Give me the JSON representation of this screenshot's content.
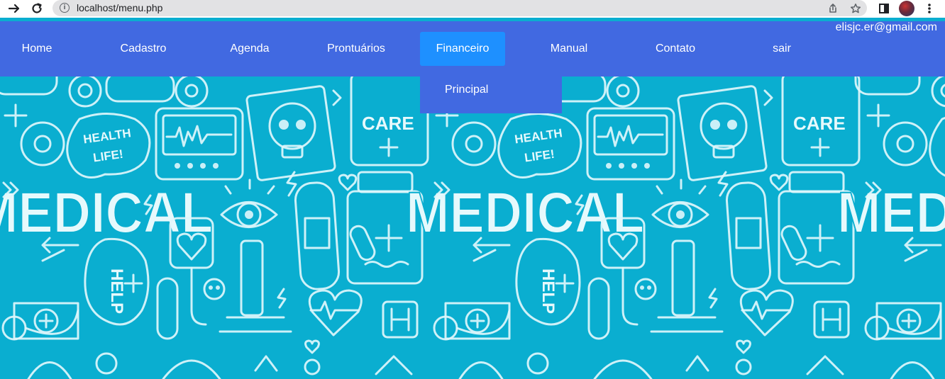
{
  "browser": {
    "url": "localhost/menu.php",
    "forward_icon": "arrow-right-icon",
    "reload_icon": "reload-icon",
    "site_info_icon": "info-icon",
    "share_icon": "share-icon",
    "bookmark_icon": "star-icon",
    "sidepanel_icon": "sidepanel-icon",
    "menu_icon": "kebab-menu-icon"
  },
  "nav": {
    "items": [
      {
        "label": "Home"
      },
      {
        "label": "Cadastro"
      },
      {
        "label": "Agenda"
      },
      {
        "label": "Prontuários"
      },
      {
        "label": "Financeiro"
      },
      {
        "label": "Manual"
      },
      {
        "label": "Contato"
      },
      {
        "label": "sair"
      }
    ],
    "active_label": "Financeiro",
    "user_email": "elisjc.er@gmail.com",
    "submenu": {
      "items": [
        {
          "label": "Principal"
        }
      ]
    }
  },
  "hero": {
    "doodle_text": [
      "MEDICAL",
      "CARE",
      "HEALTH",
      "LIFE!",
      "MEDICAL",
      "CARE",
      "HEALTH",
      "LIFE!",
      "MEDICAL",
      "HELP"
    ]
  },
  "colors": {
    "nav_bg": "#4169e1",
    "nav_active": "#1e90ff",
    "hero_bg": "#0aaed0",
    "doodle": "#dff6fb"
  }
}
